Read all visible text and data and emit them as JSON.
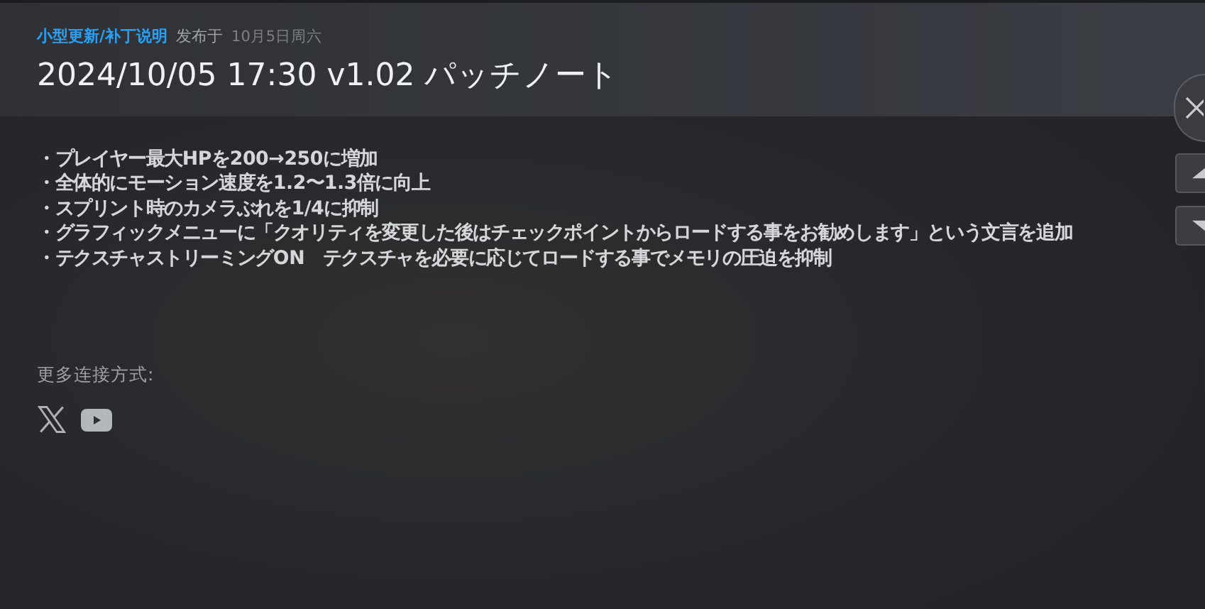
{
  "header": {
    "category": "小型更新/补丁说明",
    "published_label": "发布于",
    "date": "10月5日周六",
    "title": "2024/10/05 17:30 v1.02 パッチノート"
  },
  "notes": [
    "・プレイヤー最大HPを200→250に増加",
    "・全体的にモーション速度を1.2〜1.3倍に向上",
    "・スプリント時のカメラぶれを1/4に抑制",
    "・グラフィックメニューに「クオリティを変更した後はチェックポイントからロードする事をお勧めします」という文言を追加",
    "・テクスチャストリーミングON　テクスチャを必要に応じてロードする事でメモリの圧迫を抑制"
  ],
  "links": {
    "label": "更多连接方式:",
    "items": [
      {
        "kind": "x"
      },
      {
        "kind": "youtube"
      }
    ]
  }
}
